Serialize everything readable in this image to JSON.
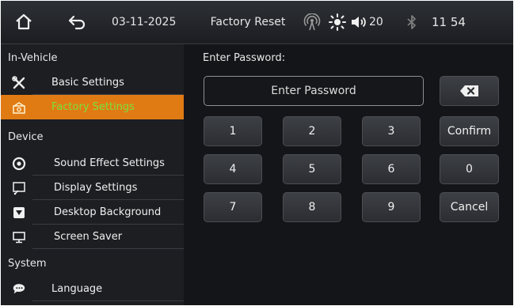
{
  "status_bar": {
    "date": "03-11-2025",
    "title": "Factory Reset",
    "volume": "20",
    "time": "11 54",
    "icons": [
      "home-icon",
      "back-arrow-icon",
      "hotspot-icon",
      "brightness-icon",
      "speaker-icon",
      "bluetooth-icon"
    ]
  },
  "sidebar": {
    "sections": [
      {
        "title": "In-Vehicle",
        "items": [
          {
            "label": "Basic Settings",
            "icon": "tools-icon"
          },
          {
            "label": "Factory Settings",
            "icon": "factory-icon",
            "active": true
          }
        ]
      },
      {
        "title": "Device",
        "items": [
          {
            "label": "Sound Effect Settings",
            "icon": "sound-effect-icon"
          },
          {
            "label": "Display Settings",
            "icon": "display-icon"
          },
          {
            "label": "Desktop Background",
            "icon": "wallpaper-icon"
          },
          {
            "label": "Screen Saver",
            "icon": "monitor-icon"
          }
        ]
      },
      {
        "title": "System",
        "items": [
          {
            "label": "Language",
            "icon": "chat-bubble-icon"
          }
        ]
      }
    ]
  },
  "main": {
    "password_label": "Enter Password:",
    "password_placeholder": "Enter Password",
    "keypad": {
      "keys": [
        "1",
        "2",
        "3",
        "4",
        "5",
        "6",
        "7",
        "8",
        "9"
      ],
      "confirm": "Confirm",
      "zero": "0",
      "cancel": "Cancel",
      "backspace_icon": "backspace-icon"
    }
  },
  "colors": {
    "active_item_bg": "#e07b14",
    "active_item_text": "#7ee03a",
    "background": "#141518"
  }
}
